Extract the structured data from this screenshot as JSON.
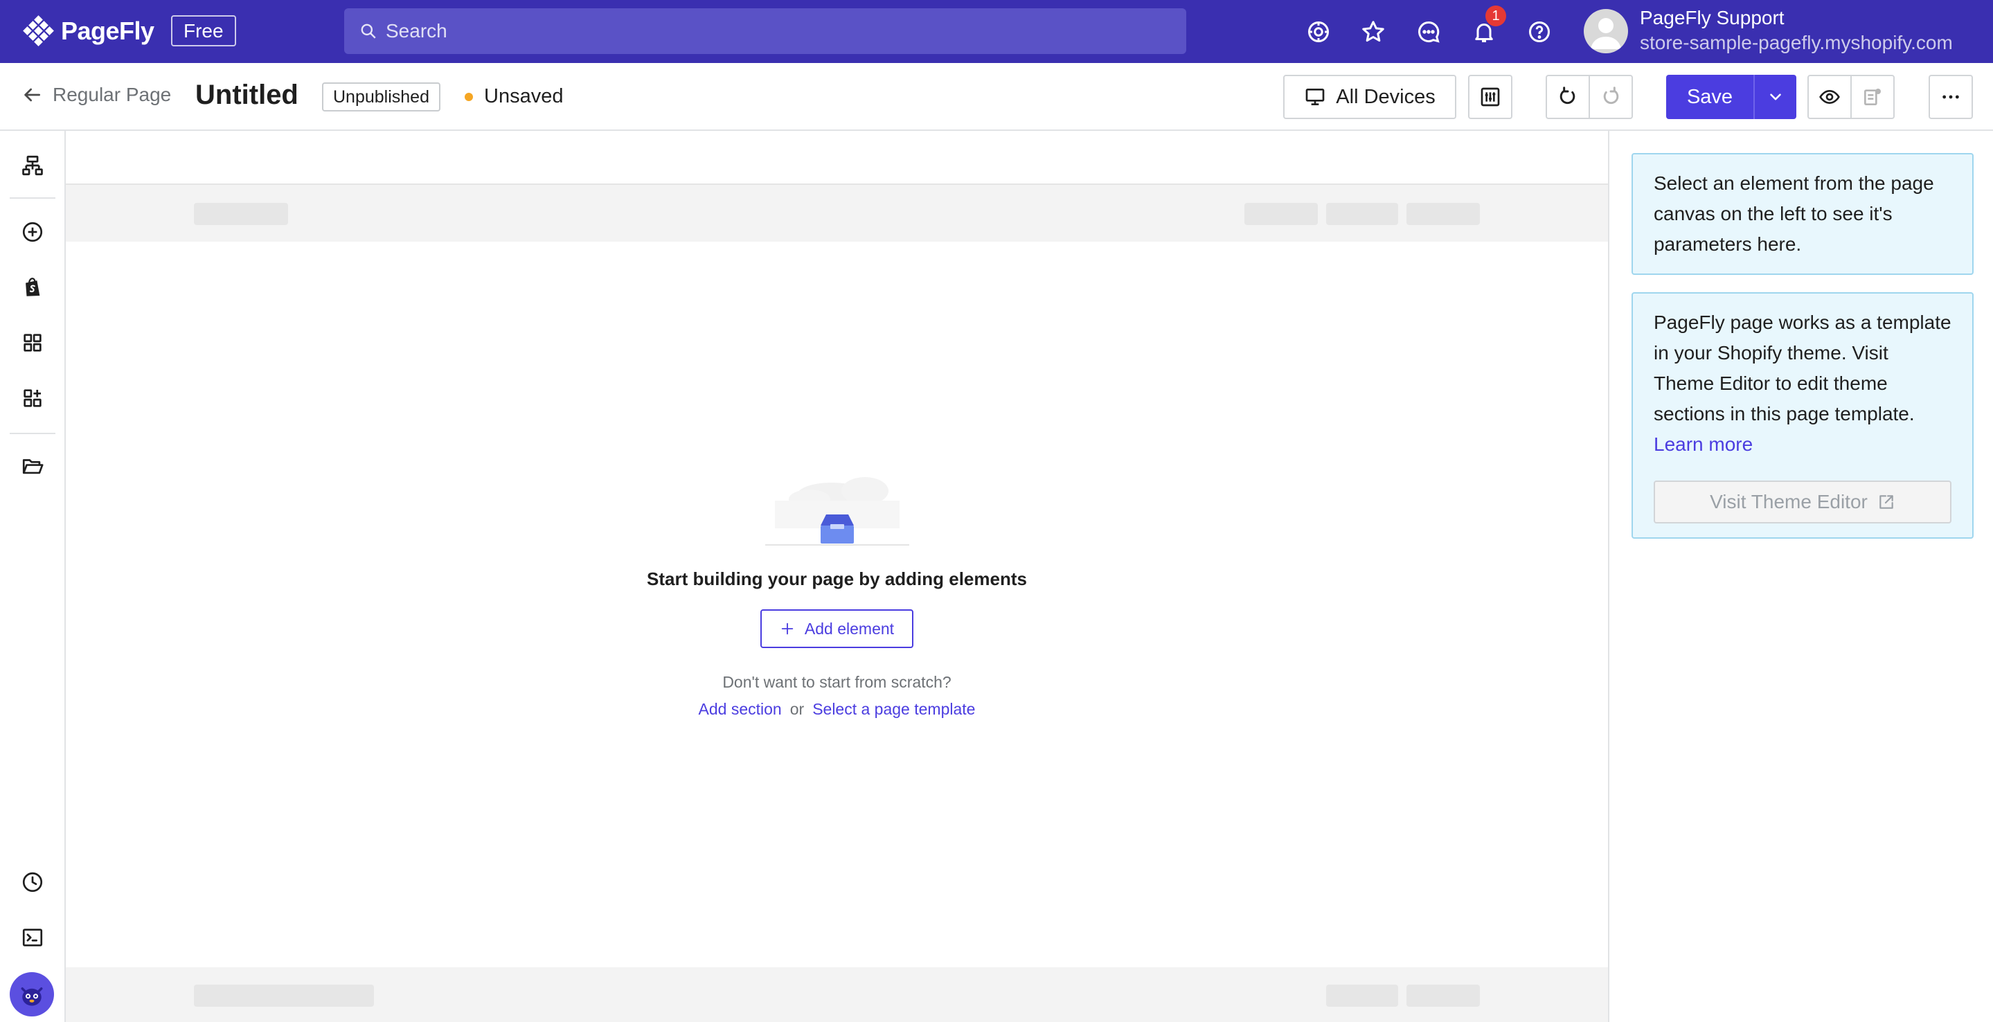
{
  "header": {
    "brand": "PageFly",
    "plan_badge": "Free",
    "search_placeholder": "Search",
    "notifications_count": "1",
    "user_name": "PageFly Support",
    "user_store": "store-sample-pagefly.myshopify.com",
    "icons": [
      "support-icon",
      "star-icon",
      "chat-icon",
      "bell-icon",
      "help-icon"
    ]
  },
  "toolbar": {
    "back_label": "Regular Page",
    "page_title": "Untitled",
    "status": "Unpublished",
    "save_state": "Unsaved",
    "devices_label": "All Devices",
    "save_label": "Save"
  },
  "sidebar": {
    "icons": [
      "page-outline-icon",
      "add-element-icon",
      "shopify-icon",
      "sections-icon",
      "apps-icon",
      "assets-icon",
      "history-icon",
      "code-icon",
      "mascot-avatar"
    ]
  },
  "canvas": {
    "empty_title": "Start building your page by adding elements",
    "add_element_label": "Add element",
    "hint": "Don't want to start from scratch?",
    "add_section_label": "Add section",
    "or_label": "or",
    "template_label": "Select a page template"
  },
  "right_panel": {
    "select_hint": "Select an element from the page canvas on the left to see it's parameters here.",
    "theme_info": "PageFly page works as a template in your Shopify theme. Visit Theme Editor to edit theme sections in this page template.",
    "learn_more": "Learn more",
    "visit_label": "Visit Theme Editor"
  },
  "colors": {
    "header_bg": "#3a2fb0",
    "accent": "#4b3de0",
    "unsaved_dot": "#f5a623",
    "info_bg": "#e8f7fd",
    "notification": "#e53935"
  }
}
